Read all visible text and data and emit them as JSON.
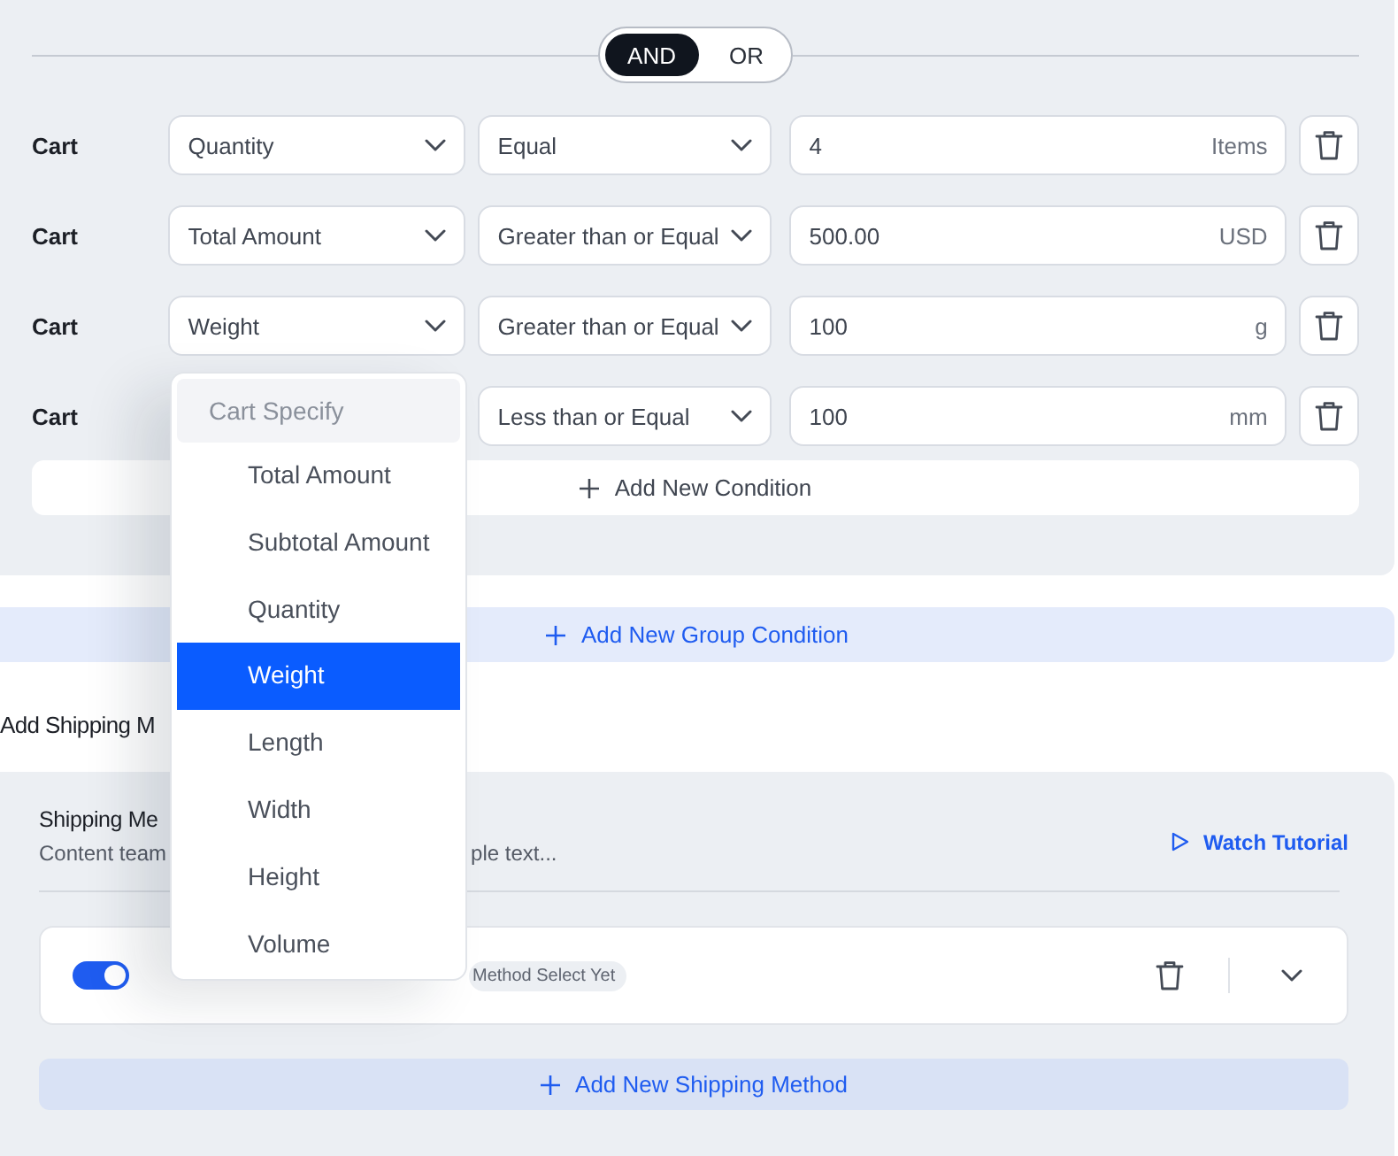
{
  "logic_toggle": [
    {
      "label": "AND",
      "selected": true
    },
    {
      "label": "OR",
      "selected": false
    }
  ],
  "conditions": [
    {
      "label": "Cart",
      "field": "Quantity",
      "operator": "Equal",
      "value": "4",
      "unit": "Items"
    },
    {
      "label": "Cart",
      "field": "Total Amount",
      "operator": "Greater than or Equal",
      "value": "500.00",
      "unit": "USD"
    },
    {
      "label": "Cart",
      "field": "Weight",
      "operator": "Greater than or Equal",
      "value": "100",
      "unit": "g"
    },
    {
      "label": "Cart",
      "operator": "Less than or Equal",
      "value": "100",
      "unit": "mm"
    }
  ],
  "add_condition": "Add New Condition",
  "add_group_condition": "Add New Group Condition",
  "field_dropdown": {
    "header": "Cart Specify",
    "items": [
      {
        "label": "Total Amount",
        "selected": false
      },
      {
        "label": "Subtotal Amount",
        "selected": false
      },
      {
        "label": "Quantity",
        "selected": false
      },
      {
        "label": "Weight",
        "selected": true
      },
      {
        "label": "Length",
        "selected": false
      },
      {
        "label": "Width",
        "selected": false
      },
      {
        "label": "Height",
        "selected": false
      },
      {
        "label": "Volume",
        "selected": false
      }
    ]
  },
  "section_heading": "Add Shipping M",
  "shipping": {
    "title": "Shipping Me",
    "description": [
      "Content team",
      "ple text..."
    ],
    "tutorial": "Watch Tutorial",
    "method": {
      "on": true,
      "badge": "Method Select Yet"
    },
    "add_method": "Add New Shipping Method"
  }
}
